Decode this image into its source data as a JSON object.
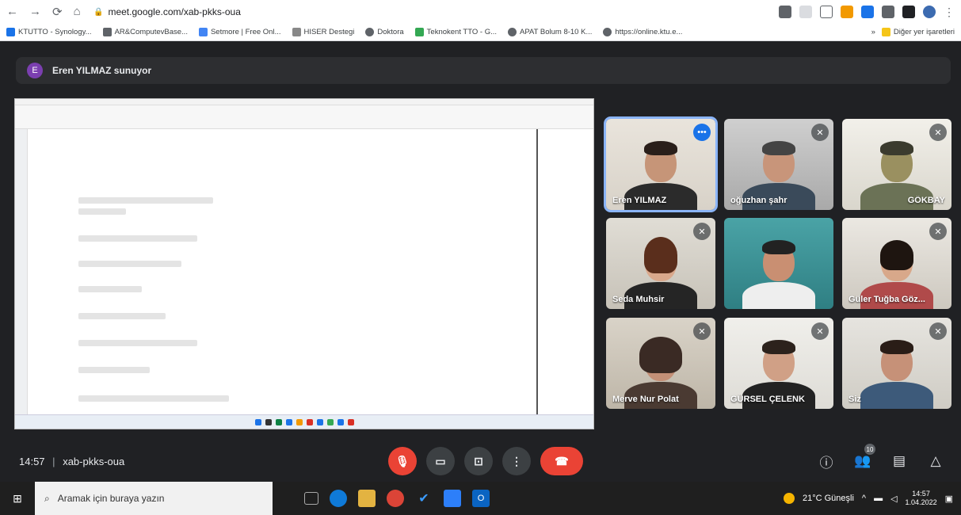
{
  "browser": {
    "url": "meet.google.com/xab-pkks-oua",
    "bookmarks": [
      "KTUTTO - Synology...",
      "AR&ComputevBase...",
      "Setmore | Free Onl...",
      "HISER Destegi",
      "Doktora",
      "Teknokent TTO - G...",
      "APAT Bolum 8-10 K...",
      "https://online.ktu.e..."
    ],
    "other_bookmarks": "Diğer yer işaretleri"
  },
  "meet": {
    "presenter_initial": "E",
    "presenting_text": "Eren YILMAZ sunuyor",
    "participants": [
      {
        "name": "Eren YILMAZ",
        "active": true
      },
      {
        "name": "oğuzhan şahr",
        "active": false
      },
      {
        "name": "GÖKBAY",
        "active": false
      },
      {
        "name": "Seda Muhsir",
        "active": false
      },
      {
        "name": "",
        "active": false
      },
      {
        "name": "Güler Tuğba Göz...",
        "active": false
      },
      {
        "name": "Merve Nur Polat",
        "active": false
      },
      {
        "name": "GÜRSEL ÇELENK",
        "active": false
      },
      {
        "name": "Siz",
        "active": false
      }
    ],
    "time": "14:57",
    "meeting_code": "xab-pkks-oua",
    "people_count": "10"
  },
  "taskbar": {
    "search_placeholder": "Aramak için buraya yazın",
    "weather": "21°C Güneşli",
    "clock_time": "14:57",
    "clock_date": "1.04.2022"
  },
  "colors": {
    "meet_bg": "#202124",
    "hangup_red": "#ea4335",
    "active_outline": "#8ab4f8"
  }
}
